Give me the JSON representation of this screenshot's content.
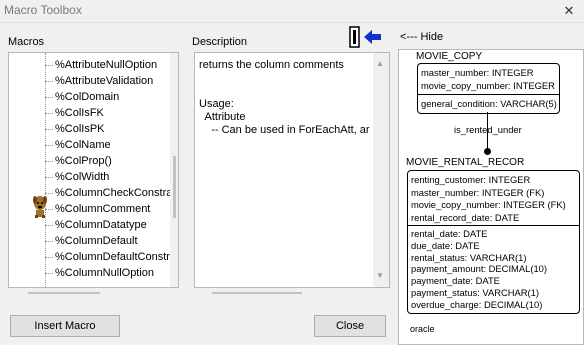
{
  "window": {
    "title": "Macro Toolbox"
  },
  "labels": {
    "macros": "Macros",
    "description": "Description",
    "hide": "<--- Hide"
  },
  "macros": [
    "%AttributeNullOption",
    "%AttributeValidation",
    "%ColDomain",
    "%ColIsFK",
    "%ColIsPK",
    "%ColName",
    "%ColProp()",
    "%ColWidth",
    "%ColumnCheckConstra",
    "%ColumnComment",
    "%ColumnDatatype",
    "%ColumnDefault",
    "%ColumnDefaultConstr",
    "%ColumnNullOption"
  ],
  "description": {
    "text": "returns the column comments\n\n\nUsage:\n  Attribute\n    -- Can be used in ForEachAtt, ar"
  },
  "buttons": {
    "insert": "Insert Macro",
    "close": "Close"
  },
  "diagram": {
    "entity1": {
      "name": "MOVIE_COPY",
      "key_attrs": [
        "master_number: INTEGER",
        "movie_copy_number: INTEGER"
      ],
      "attrs": [
        "general_condition: VARCHAR(5)"
      ]
    },
    "relationship": "is_rented_under",
    "entity2": {
      "name": "MOVIE_RENTAL_RECOR",
      "key_attrs": [
        "renting_customer: INTEGER",
        "master_number: INTEGER (FK)",
        "movie_copy_number: INTEGER (FK)",
        "rental_record_date: DATE"
      ],
      "attrs": [
        "rental_date: DATE",
        "due_date: DATE",
        "rental_status: VARCHAR(1)",
        "payment_amount: DECIMAL(10)",
        "payment_date: DATE",
        "payment_status: VARCHAR(1)",
        "overdue_charge: DECIMAL(10)"
      ]
    },
    "footer": "oracle"
  },
  "icons": {
    "arrow": "left-arrow-icon",
    "cursor": "dog-cursor-icon"
  }
}
